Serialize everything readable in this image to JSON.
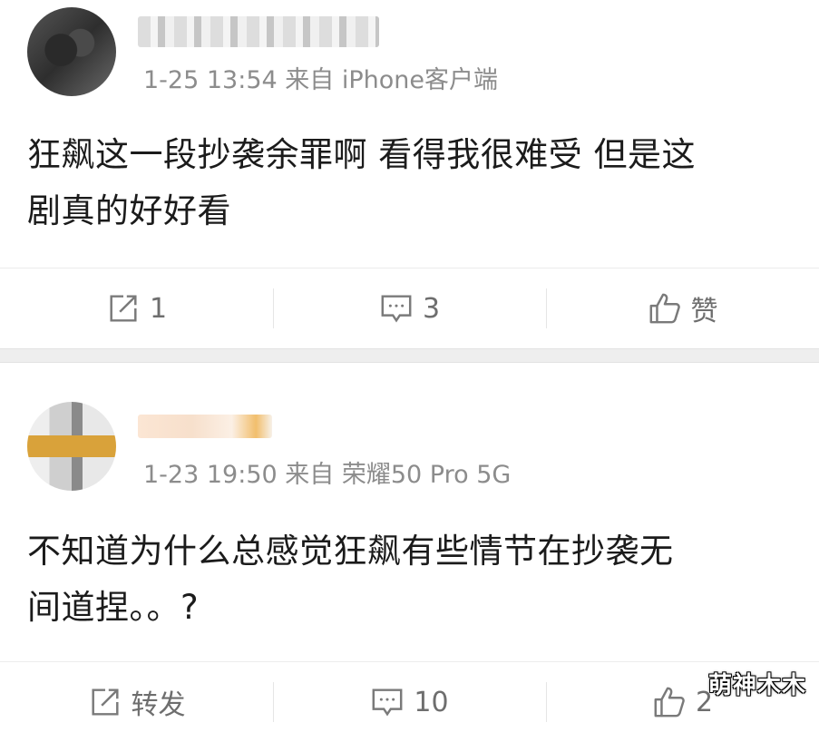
{
  "comments": [
    {
      "meta": "1-25 13:54 来自 iPhone客户端",
      "text_line1": "狂飙这一段抄袭余罪啊 看得我很难受 但是这",
      "text_line2": "剧真的好好看",
      "actions": {
        "repost": "1",
        "comment": "3",
        "like": "赞"
      }
    },
    {
      "meta": "1-23 19:50 来自 荣耀50 Pro 5G",
      "text_line1": "不知道为什么总感觉狂飙有些情节在抄袭无",
      "text_line2": "间道捏。。?",
      "actions": {
        "repost": "转发",
        "comment": "10",
        "like": "2"
      }
    }
  ],
  "watermark": "萌神木木",
  "icons": [
    "repost-icon",
    "comment-icon",
    "like-icon"
  ],
  "colors": {
    "meta_gray": "#8c8c8c",
    "action_gray": "#6e6e6e",
    "separator": "#eeeeee"
  }
}
